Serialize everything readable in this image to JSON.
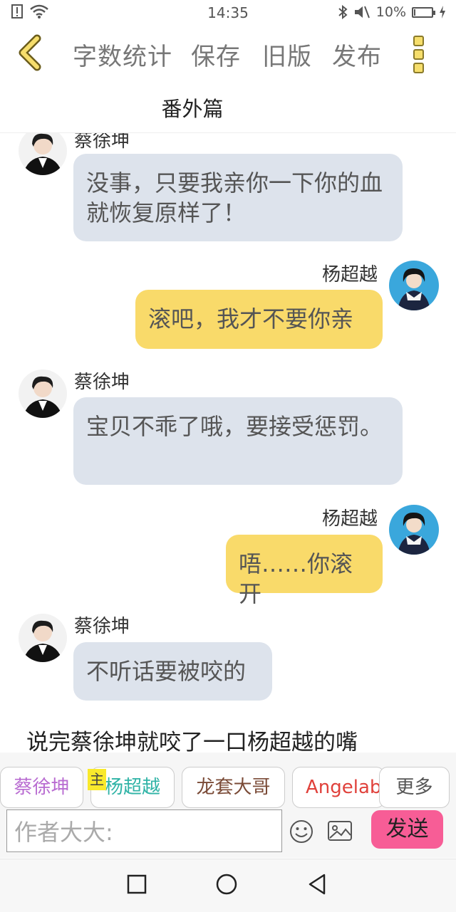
{
  "status_bar": {
    "time": "14:35",
    "battery": "10%",
    "battery_level": 0.1,
    "icons": [
      "alert-icon",
      "wifi-icon",
      "bluetooth-icon",
      "mute-icon",
      "battery-icon",
      "charging-icon"
    ]
  },
  "toolbar": {
    "word_count": "字数统计",
    "save": "保存",
    "old_version": "旧版",
    "publish": "发布"
  },
  "subtitle": "番外篇",
  "messages": [
    {
      "speaker": "蔡徐坤",
      "side": "left",
      "text": "没事，只要我亲你一下你的血就恢复原样了！"
    },
    {
      "speaker": "杨超越",
      "side": "right",
      "text": "滚吧，我才不要你亲"
    },
    {
      "speaker": "蔡徐坤",
      "side": "left",
      "text": "宝贝不乖了哦，要接受惩罚。"
    },
    {
      "speaker": "杨超越",
      "side": "right",
      "text": "唔……你滚开"
    },
    {
      "speaker": "蔡徐坤",
      "side": "left",
      "text": "不听话要被咬的"
    }
  ],
  "narration": "说完蔡徐坤就咬了一口杨超越的嘴",
  "characters": [
    {
      "name": "蔡徐坤",
      "color": "#b86bd1"
    },
    {
      "name": "杨超越",
      "color": "#2fb3a6"
    },
    {
      "name": "龙套大哥",
      "color": "#7a4a36"
    },
    {
      "name": "Angelababy",
      "color": "#e0413b"
    }
  ],
  "main_tag": "主",
  "more_chars": "更多",
  "input": {
    "placeholder": "作者大大:"
  },
  "send": "发送"
}
